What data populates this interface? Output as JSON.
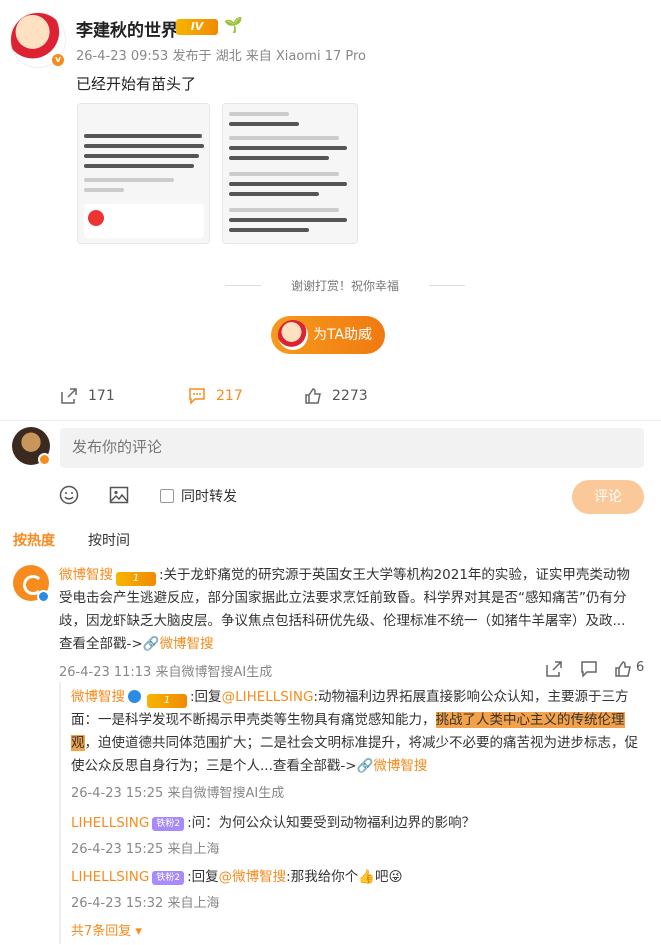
{
  "post": {
    "username": "李建秋的世界",
    "vip_label": "IV",
    "meta": "26-4-23 09:53  发布于 湖北  来自 Xiaomi 17 Pro",
    "text": "已经开始有苗头了",
    "reward_text": "谢谢打赏！祝你幸福",
    "cheer_label": "为TA助威"
  },
  "actions": {
    "forwards": "171",
    "comments": "217",
    "likes": "2273"
  },
  "composer": {
    "placeholder": "发布你的评论",
    "repost_label": "同时转发",
    "submit_label": "评论"
  },
  "sort": {
    "hot": "按热度",
    "time": "按时间"
  },
  "comment": {
    "username": "微博智搜",
    "vip_label": "1",
    "text": ":关于龙虾痛觉的研究源于英国女王大学等机构2021年的实验，证实甲壳类动物受电击会产生逃避反应，部分国家据此立法要求烹饪前致昏。科学界对其是否“感知痛苦”仍有分歧，因龙虾缺乏大脑皮层。争议焦点包括科研优先级、伦理标准不统一（如猪牛羊屠宰）及政...",
    "more_label": "查看全部戳->",
    "link_label": "微博智搜",
    "meta": "26-4-23 11:13  来自微博智搜AI生成",
    "likes": "6"
  },
  "replies": [
    {
      "username": "微博智搜",
      "vip_label": "1",
      "prefix": ":回复",
      "mention": "@LIHELLSING",
      "text_before": ":动物福利边界拓展直接影响公众认知，主要源于三方面：一是科学发现不断揭示甲壳类等生物具有痛觉感知能力，",
      "highlight": "挑战了人类中心主义的传统伦理观",
      "text_after": "，迫使道德共同体范围扩大；二是社会文明标准提升，将减少不必要的痛苦视为进步标志，促使公众反思自身行为；三是个人...查看全部戳->",
      "link_label": "微博智搜",
      "meta": "26-4-23 15:25  来自微博智搜AI生成"
    },
    {
      "username": "LIHELLSING",
      "tag": "铁粉2",
      "text": ":问：为何公众认知要受到动物福利边界的影响？",
      "meta": "26-4-23 15:25  来自上海"
    },
    {
      "username": "LIHELLSING",
      "tag": "铁粉2",
      "prefix": ":回复",
      "mention": "@微博智搜",
      "text": ":那我给你个👍吧😜",
      "meta": "26-4-23 15:32  来自上海"
    }
  ],
  "more_replies": "共7条回复 ▾",
  "colors": {
    "accent": "#f78b1e",
    "muted": "#888888"
  }
}
